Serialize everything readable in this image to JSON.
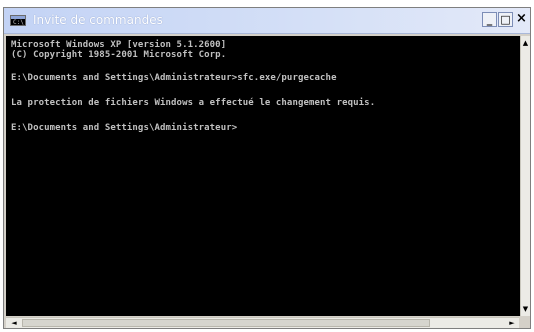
{
  "window": {
    "title": "Invite de commandes",
    "icon": "console-icon",
    "controls": {
      "minimize_label": "_",
      "maximize_label": "□",
      "close_label": "×"
    }
  },
  "console": {
    "lines": [
      "Microsoft Windows XP [version 5.1.2600]",
      "(C) Copyright 1985-2001 Microsoft Corp.",
      "",
      "E:\\Documents and Settings\\Administrateur>sfc.exe/purgecache",
      "",
      "La protection de fichiers Windows a effectué le changement requis.",
      "",
      "E:\\Documents and Settings\\Administrateur>"
    ]
  },
  "scrollbars": {
    "up_arrow": "▲",
    "down_arrow": "▼",
    "left_arrow": "◄",
    "right_arrow": "►"
  },
  "colors": {
    "console_bg": "#000000",
    "console_text": "#c0c0c0",
    "titlebar": "#c3d3f5"
  }
}
